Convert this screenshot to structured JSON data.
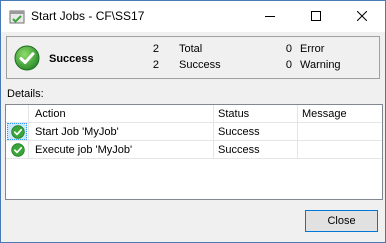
{
  "window": {
    "title": "Start Jobs - CF\\SS17"
  },
  "summary": {
    "status": "Success",
    "total_count": "2",
    "total_label": "Total",
    "success_count": "2",
    "success_label": "Success",
    "error_count": "0",
    "error_label": "Error",
    "warning_count": "0",
    "warning_label": "Warning"
  },
  "details": {
    "label": "Details:",
    "columns": [
      "Action",
      "Status",
      "Message"
    ],
    "rows": [
      {
        "action": "Start Job 'MyJob'",
        "status": "Success",
        "message": ""
      },
      {
        "action": "Execute job 'MyJob'",
        "status": "Success",
        "message": ""
      }
    ]
  },
  "buttons": {
    "close_label": "Close"
  },
  "colors": {
    "success_green": "#3aa63a",
    "accent_blue": "#0078d7"
  },
  "icons": {
    "app": "jobs-icon",
    "summary": "success-check-icon",
    "row": "success-check-icon"
  }
}
